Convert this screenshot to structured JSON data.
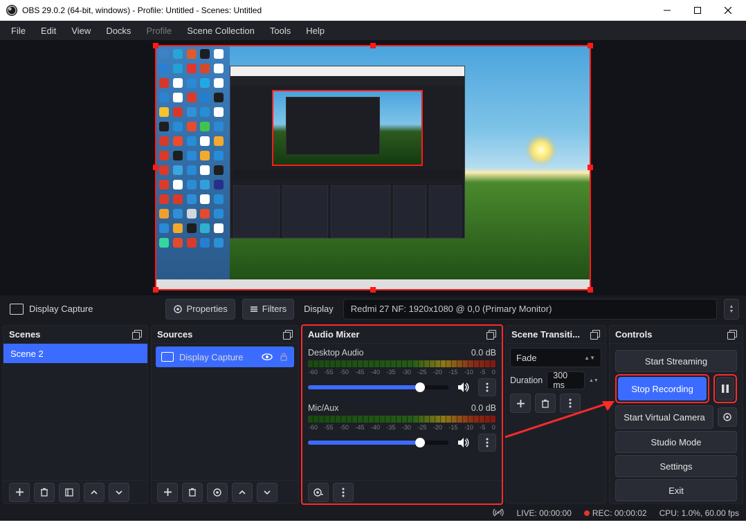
{
  "titlebar": {
    "title": "OBS 29.0.2 (64-bit, windows) - Profile: Untitled - Scenes: Untitled"
  },
  "menu": {
    "file": "File",
    "edit": "Edit",
    "view": "View",
    "docks": "Docks",
    "profile": "Profile",
    "scene_collection": "Scene Collection",
    "tools": "Tools",
    "help": "Help"
  },
  "toolbar": {
    "source_label": "Display Capture",
    "properties": "Properties",
    "filters": "Filters",
    "display_label": "Display",
    "display_value": "Redmi 27 NF: 1920x1080 @ 0,0 (Primary Monitor)"
  },
  "panels": {
    "scenes_title": "Scenes",
    "sources_title": "Sources",
    "mixer_title": "Audio Mixer",
    "transitions_title": "Scene Transiti...",
    "controls_title": "Controls"
  },
  "scenes": {
    "items": [
      "Scene 2"
    ]
  },
  "sources": {
    "items": [
      "Display Capture"
    ]
  },
  "mixer": {
    "ticks": [
      "-60",
      "-55",
      "-50",
      "-45",
      "-40",
      "-35",
      "-30",
      "-25",
      "-20",
      "-15",
      "-10",
      "-5",
      "0"
    ],
    "channels": [
      {
        "name": "Desktop Audio",
        "db": "0.0 dB"
      },
      {
        "name": "Mic/Aux",
        "db": "0.0 dB"
      }
    ]
  },
  "transitions": {
    "type": "Fade",
    "duration_label": "Duration",
    "duration_value": "300 ms"
  },
  "controls": {
    "start_streaming": "Start Streaming",
    "stop_recording": "Stop Recording",
    "start_virtual_camera": "Start Virtual Camera",
    "studio_mode": "Studio Mode",
    "settings": "Settings",
    "exit": "Exit"
  },
  "status": {
    "live": "LIVE: 00:00:00",
    "rec": "REC: 00:00:02",
    "cpu": "CPU: 1.0%, 60.00 fps"
  }
}
